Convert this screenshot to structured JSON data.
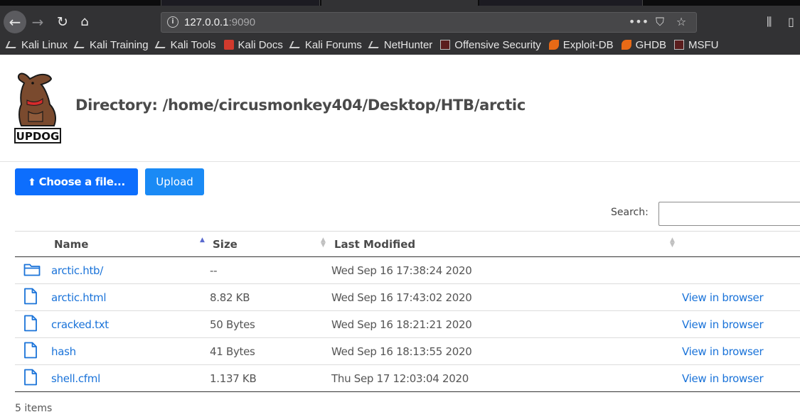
{
  "browser": {
    "url_host": "127.0.0.1",
    "url_port": ":9090",
    "bookmarks": [
      {
        "label": "Kali Linux",
        "icon": "kali-dragon-icon"
      },
      {
        "label": "Kali Training",
        "icon": "kali-dragon-icon"
      },
      {
        "label": "Kali Tools",
        "icon": "kali-dragon-icon"
      },
      {
        "label": "Kali Docs",
        "icon": "kali-docs-icon"
      },
      {
        "label": "Kali Forums",
        "icon": "kali-dragon-icon"
      },
      {
        "label": "NetHunter",
        "icon": "nethunter-icon"
      },
      {
        "label": "Offensive Security",
        "icon": "offsec-icon"
      },
      {
        "label": "Exploit-DB",
        "icon": "exploit-db-icon"
      },
      {
        "label": "GHDB",
        "icon": "ghdb-icon"
      },
      {
        "label": "MSFU",
        "icon": "offsec-icon"
      }
    ]
  },
  "page": {
    "logo_text": "UPDOG",
    "title": "Directory: /home/circusmonkey404/Desktop/HTB/arctic",
    "choose_label": "Choose a file...",
    "upload_label": "Upload",
    "search_label": "Search:",
    "search_value": "",
    "footer": "5 items"
  },
  "table": {
    "headers": {
      "name": "Name",
      "size": "Size",
      "modified": "Last Modified"
    },
    "rows": [
      {
        "type": "folder",
        "name": "arctic.htb/",
        "size": "--",
        "modified": "Wed Sep 16 17:38:24 2020",
        "action": ""
      },
      {
        "type": "file",
        "name": "arctic.html",
        "size": "8.82 KB",
        "modified": "Wed Sep 16 17:43:02 2020",
        "action": "View in browser"
      },
      {
        "type": "file",
        "name": "cracked.txt",
        "size": "50 Bytes",
        "modified": "Wed Sep 16 18:21:21 2020",
        "action": "View in browser"
      },
      {
        "type": "file",
        "name": "hash",
        "size": "41 Bytes",
        "modified": "Wed Sep 16 18:13:55 2020",
        "action": "View in browser"
      },
      {
        "type": "file",
        "name": "shell.cfml",
        "size": "1.137 KB",
        "modified": "Thu Sep 17 12:03:04 2020",
        "action": "View in browser"
      }
    ]
  },
  "colors": {
    "primary": "#0d6efd",
    "link": "#1a73d9",
    "browser_toolbar": "#323234"
  }
}
